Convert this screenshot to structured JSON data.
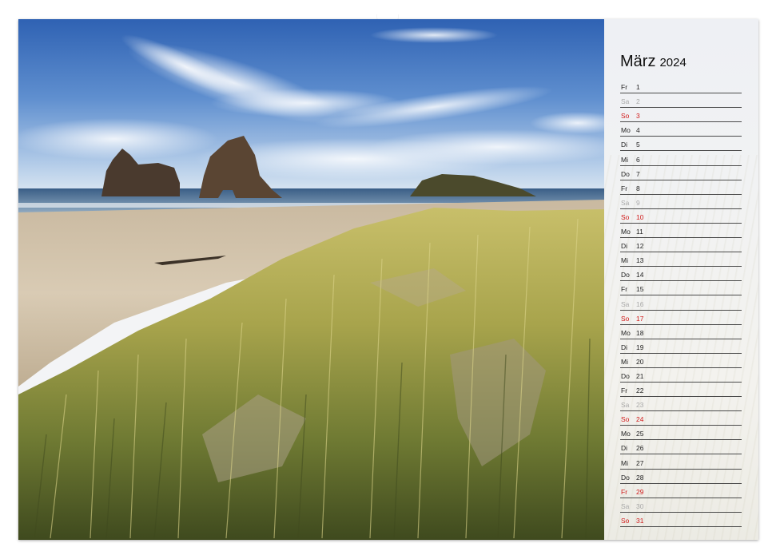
{
  "calendar": {
    "month": "März",
    "year": "2024",
    "days": [
      {
        "wd": "Fr",
        "d": "1",
        "type": "weekday"
      },
      {
        "wd": "Sa",
        "d": "2",
        "type": "sa"
      },
      {
        "wd": "So",
        "d": "3",
        "type": "su"
      },
      {
        "wd": "Mo",
        "d": "4",
        "type": "weekday"
      },
      {
        "wd": "Di",
        "d": "5",
        "type": "weekday"
      },
      {
        "wd": "Mi",
        "d": "6",
        "type": "weekday"
      },
      {
        "wd": "Do",
        "d": "7",
        "type": "weekday"
      },
      {
        "wd": "Fr",
        "d": "8",
        "type": "weekday"
      },
      {
        "wd": "Sa",
        "d": "9",
        "type": "sa"
      },
      {
        "wd": "So",
        "d": "10",
        "type": "su"
      },
      {
        "wd": "Mo",
        "d": "11",
        "type": "weekday"
      },
      {
        "wd": "Di",
        "d": "12",
        "type": "weekday"
      },
      {
        "wd": "Mi",
        "d": "13",
        "type": "weekday"
      },
      {
        "wd": "Do",
        "d": "14",
        "type": "weekday"
      },
      {
        "wd": "Fr",
        "d": "15",
        "type": "weekday"
      },
      {
        "wd": "Sa",
        "d": "16",
        "type": "sa"
      },
      {
        "wd": "So",
        "d": "17",
        "type": "su"
      },
      {
        "wd": "Mo",
        "d": "18",
        "type": "weekday"
      },
      {
        "wd": "Di",
        "d": "19",
        "type": "weekday"
      },
      {
        "wd": "Mi",
        "d": "20",
        "type": "weekday"
      },
      {
        "wd": "Do",
        "d": "21",
        "type": "weekday"
      },
      {
        "wd": "Fr",
        "d": "22",
        "type": "weekday"
      },
      {
        "wd": "Sa",
        "d": "23",
        "type": "sa"
      },
      {
        "wd": "So",
        "d": "24",
        "type": "su"
      },
      {
        "wd": "Mo",
        "d": "25",
        "type": "weekday"
      },
      {
        "wd": "Di",
        "d": "26",
        "type": "weekday"
      },
      {
        "wd": "Mi",
        "d": "27",
        "type": "weekday"
      },
      {
        "wd": "Do",
        "d": "28",
        "type": "weekday"
      },
      {
        "wd": "Fr",
        "d": "29",
        "type": "holiday"
      },
      {
        "wd": "Sa",
        "d": "30",
        "type": "sa"
      },
      {
        "wd": "So",
        "d": "31",
        "type": "su"
      }
    ]
  },
  "colors": {
    "sunday": "#d11b1b",
    "saturday": "#a9a9a9",
    "text": "#222222"
  }
}
